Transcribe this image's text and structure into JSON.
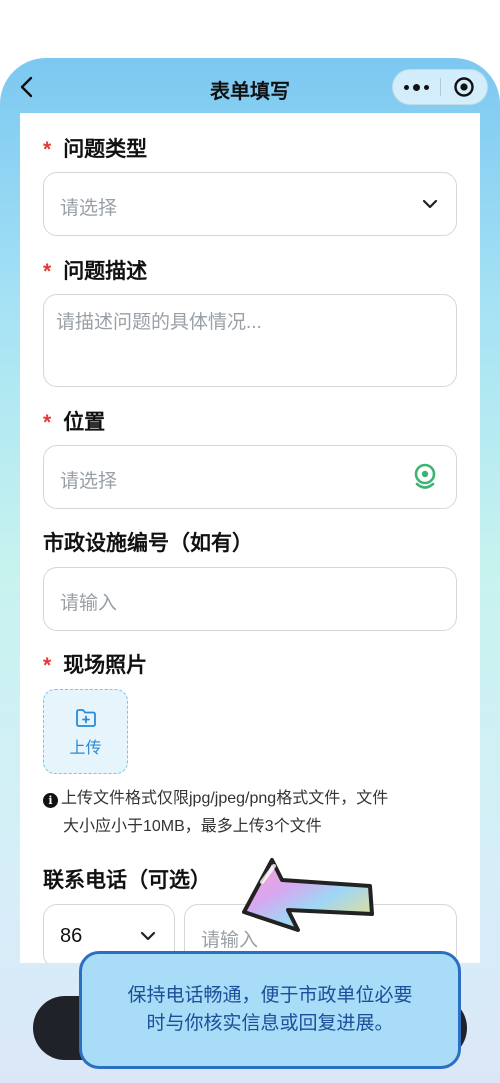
{
  "nav": {
    "title": "表单填写",
    "back_icon": "chevron-left-icon",
    "more_icon": "more-dots-icon",
    "target_icon": "target-icon"
  },
  "form": {
    "problem_type": {
      "label": "问题类型",
      "required_mark": "*",
      "placeholder": "请选择"
    },
    "description": {
      "label": "问题描述",
      "required_mark": "*",
      "placeholder": "请描述问题的具体情况..."
    },
    "location": {
      "label": "位置",
      "required_mark": "*",
      "placeholder": "请选择"
    },
    "facility_id": {
      "label": "市政设施编号（如有）",
      "placeholder": "请输入"
    },
    "photos": {
      "label": "现场照片",
      "required_mark": "*",
      "upload_label": "上传",
      "note_line1": "上传文件格式仅限jpg/jpeg/png格式文件，文件",
      "note_line2": "大小应小于10MB，最多上传3个文件"
    },
    "phone": {
      "label": "联系电话（可选）",
      "country_code": "86",
      "placeholder": "请输入"
    }
  },
  "tooltip": {
    "line1": "保持电话畅通，便于市政单位必要",
    "line2": "时与你核实信息或回复进展。"
  },
  "colors": {
    "accent": "#2a8bd4",
    "required": "#e53935",
    "location_icon": "#3cb371"
  }
}
